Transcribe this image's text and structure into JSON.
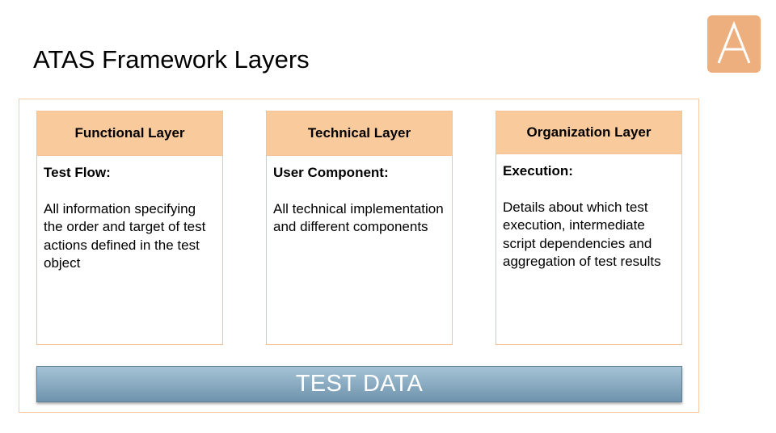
{
  "slide": {
    "title": "ATAS Framework Layers"
  },
  "logo": {
    "letter": "A",
    "color": "#eeaf7e"
  },
  "layers": [
    {
      "header": "Functional Layer",
      "subtitle": "Test Flow:",
      "description": "All information specifying the order and target of test actions defined in the test object"
    },
    {
      "header": "Technical Layer",
      "subtitle": "User Component:",
      "description": "All technical implementation and different components"
    },
    {
      "header": "Organization Layer",
      "subtitle": "Execution:",
      "description": "Details about which test execution, intermediate script dependencies and aggregation of test results"
    }
  ],
  "test_data": {
    "label": "TEST DATA"
  },
  "colors": {
    "header_fill": "#f9cb9c",
    "border": "#f4c39a",
    "test_data_bar": "#7fa2b9"
  }
}
